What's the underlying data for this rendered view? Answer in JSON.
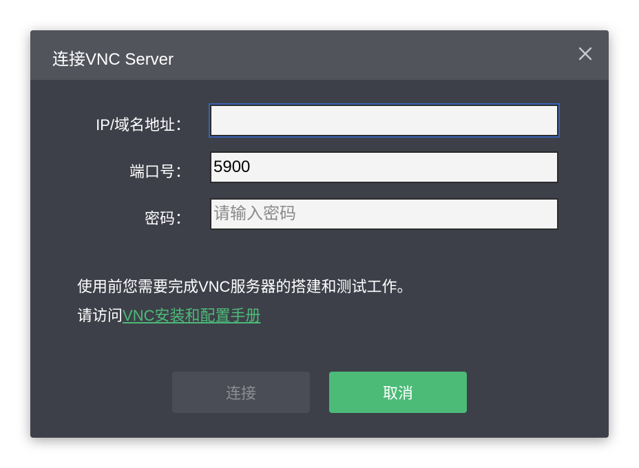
{
  "dialog": {
    "title": "连接VNC Server",
    "close_icon": "close-icon"
  },
  "form": {
    "ip_label": "IP/域名地址：",
    "ip_value": "",
    "port_label": "端口号：",
    "port_value": "5900",
    "password_label": "密码：",
    "password_placeholder": "请输入密码"
  },
  "note": {
    "line1": "使用前您需要完成VNC服务器的搭建和测试工作。",
    "line2_prefix": "请访问",
    "link_text": "VNC安装和配置手册"
  },
  "buttons": {
    "connect": "连接",
    "cancel": "取消"
  },
  "colors": {
    "header": "#52545c",
    "body": "#3e4049",
    "accent": "#4cbb78",
    "focus": "#3a63b8"
  }
}
